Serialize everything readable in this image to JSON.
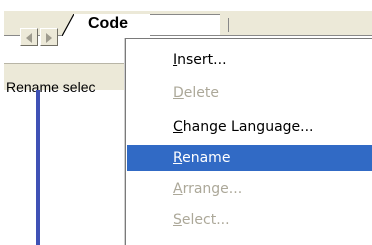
{
  "tabs": {
    "active_label": "Code"
  },
  "statusbar": {
    "text": "Rename selec"
  },
  "context_menu": {
    "items": [
      {
        "access_key": "I",
        "rest": "nsert...",
        "enabled": true,
        "selected": false
      },
      {
        "access_key": "D",
        "rest": "elete",
        "enabled": false,
        "selected": false
      },
      {
        "access_key": "C",
        "rest": "hange Language...",
        "enabled": true,
        "selected": false
      },
      {
        "access_key": "R",
        "rest": "ename",
        "enabled": true,
        "selected": true
      },
      {
        "access_key": "A",
        "rest": "rrange...",
        "enabled": false,
        "selected": false
      },
      {
        "access_key": "S",
        "rest": "elect...",
        "enabled": false,
        "selected": false
      }
    ]
  },
  "colors": {
    "selection": "#316ac5",
    "disabled_text": "#aca899",
    "chrome": "#ece9d8",
    "accent_line": "#3f51b5"
  },
  "icons": {
    "scroll_left": "triangle-left-icon",
    "scroll_right": "triangle-right-icon"
  }
}
